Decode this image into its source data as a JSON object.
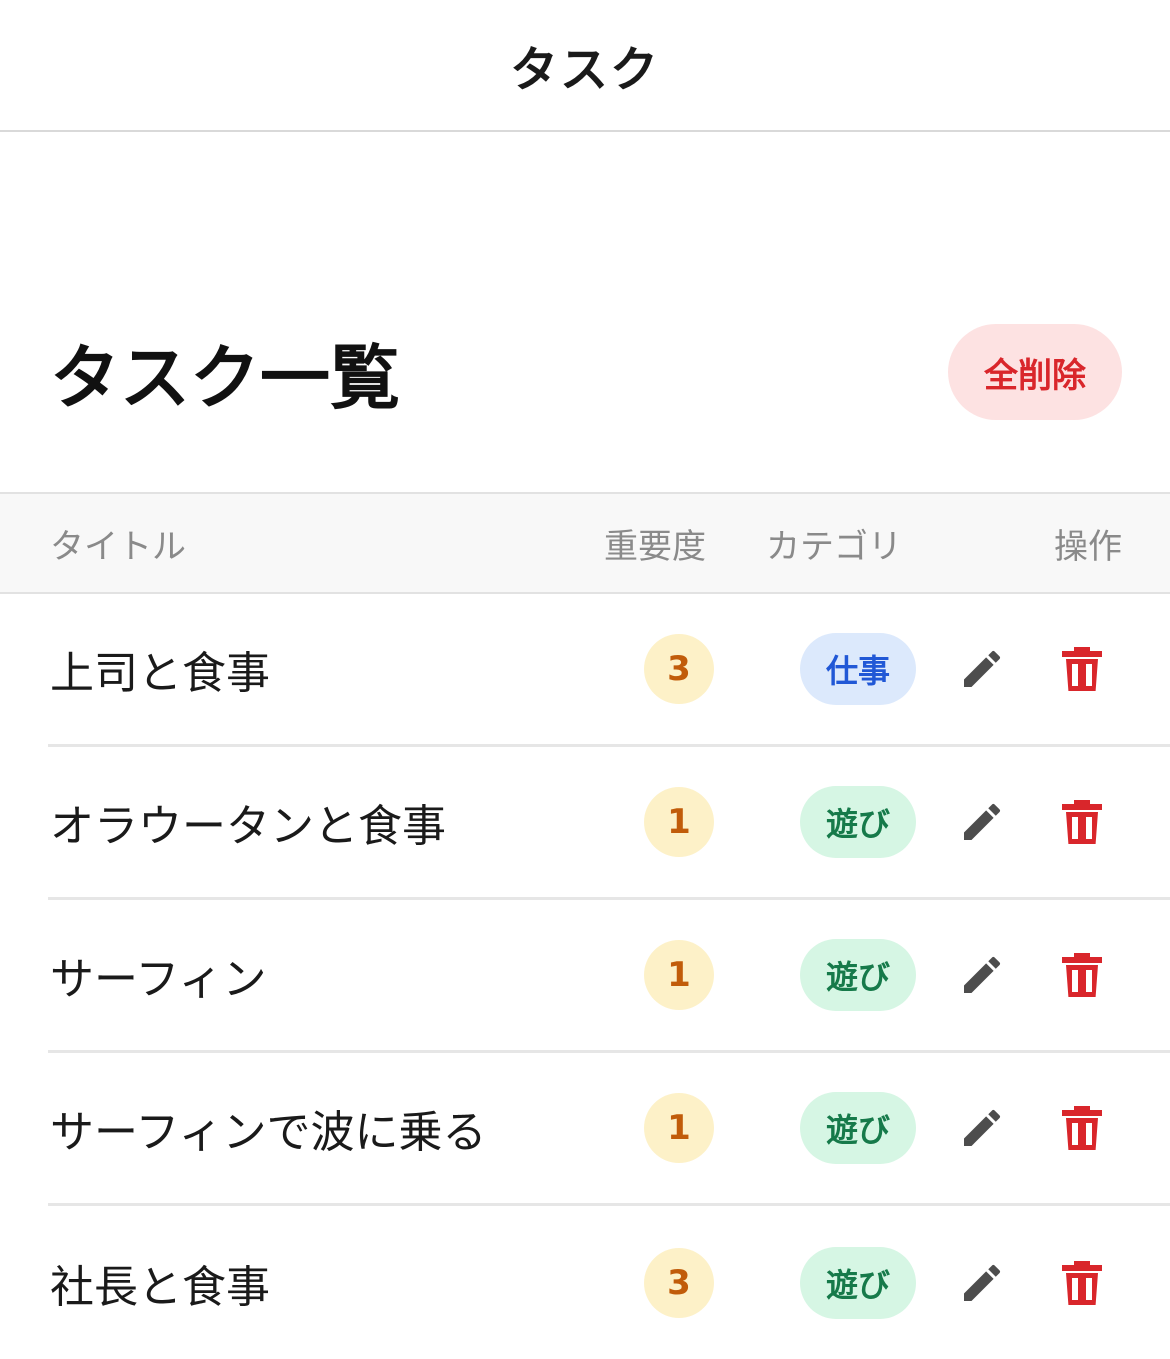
{
  "nav": {
    "title": "タスク"
  },
  "list": {
    "title": "タスク一覧",
    "delete_all_label": "全削除"
  },
  "table": {
    "headers": {
      "title": "タイトル",
      "importance": "重要度",
      "category": "カテゴリ",
      "actions": "操作"
    },
    "rows": [
      {
        "title": "上司と食事",
        "importance": "3",
        "category": "仕事",
        "category_type": "work"
      },
      {
        "title": "オラウータンと食事",
        "importance": "1",
        "category": "遊び",
        "category_type": "play"
      },
      {
        "title": "サーフィン",
        "importance": "1",
        "category": "遊び",
        "category_type": "play"
      },
      {
        "title": "サーフィンで波に乗る",
        "importance": "1",
        "category": "遊び",
        "category_type": "play"
      },
      {
        "title": "社長と食事",
        "importance": "3",
        "category": "遊び",
        "category_type": "play"
      }
    ]
  },
  "colors": {
    "delete_red": "#d9262b",
    "edit_gray": "#4d4d4d",
    "importance_bg": "#fdf1c8",
    "importance_text": "#c15c0a",
    "work_bg": "#dce9fc",
    "work_text": "#2158d6",
    "play_bg": "#d6f6e4",
    "play_text": "#167a4a"
  },
  "icons": {
    "edit": "pencil-icon",
    "delete": "trash-icon"
  }
}
